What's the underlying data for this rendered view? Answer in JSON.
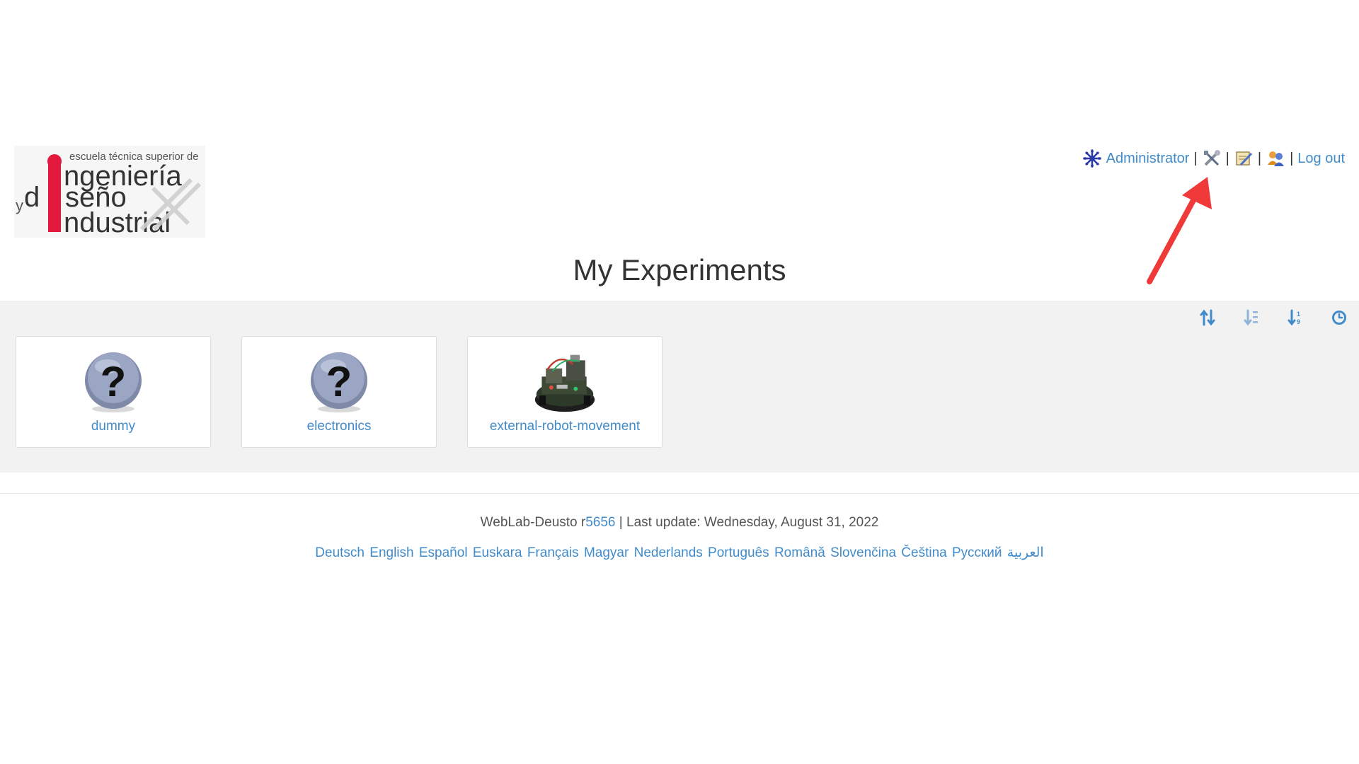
{
  "header": {
    "logo": {
      "line1": "escuela técnica superior de",
      "line2": "ngeniería",
      "line3": "y",
      "line4": "d",
      "line5": "seño",
      "line6": "ndustrial"
    },
    "user_bar": {
      "user_name": "Administrator",
      "separator": "|",
      "logout_label": "Log out",
      "icons": [
        "institution-logo-icon",
        "admin-tools-icon",
        "edit-profile-icon",
        "users-icon"
      ]
    }
  },
  "main": {
    "title": "My Experiments",
    "sort_tools": [
      "sort-toggle-icon",
      "sort-alpha-icon",
      "sort-numeric-icon",
      "sort-recent-icon"
    ],
    "experiments": [
      {
        "label": "dummy",
        "icon": "question-mark-icon"
      },
      {
        "label": "electronics",
        "icon": "question-mark-icon"
      },
      {
        "label": "external-robot-movement",
        "icon": "robot-icon"
      }
    ]
  },
  "footer": {
    "product": "WebLab-Deusto",
    "revision_prefix": "r",
    "revision": "5656",
    "last_update": "| Last update: Wednesday, August 31, 2022",
    "languages": [
      "Deutsch",
      "English",
      "Español",
      "Euskara",
      "Français",
      "Magyar",
      "Nederlands",
      "Português",
      "Română",
      "Slovenčina",
      "Čeština",
      "Русский",
      "العربية"
    ]
  },
  "colors": {
    "link": "#428bca",
    "panel_bg": "#f2f2f2",
    "logo_red": "#e2183d",
    "annotation": "#f03a3a"
  }
}
